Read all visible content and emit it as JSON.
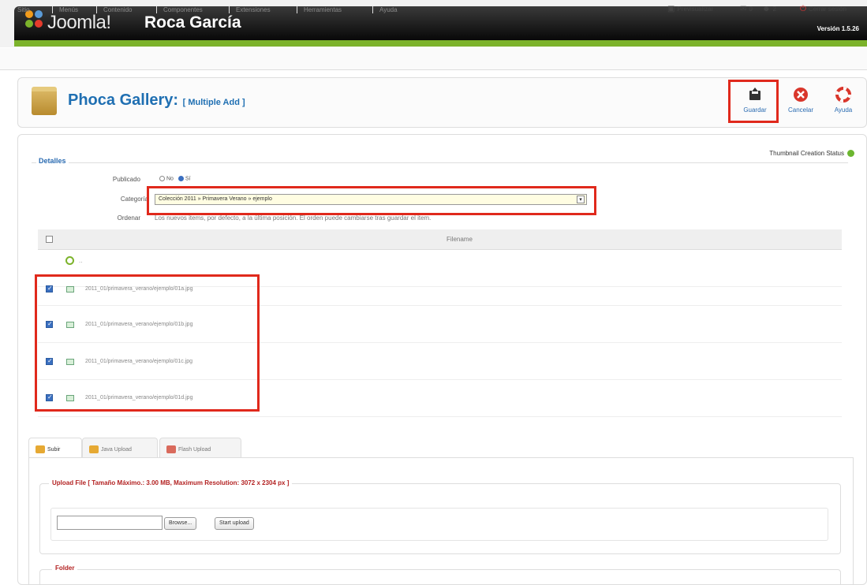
{
  "header": {
    "logo_text": "Joomla!",
    "site_name": "Roca García",
    "version": "Versión 1.5.26"
  },
  "menu": {
    "items": [
      "Sitio",
      "Menús",
      "Contenido",
      "Componentes",
      "Extensiones",
      "Herramientas",
      "Ayuda"
    ],
    "preview": "Previsualizar",
    "messages_count": "0",
    "users_count": "2",
    "logout": "Cerrar sesión"
  },
  "toolbar": {
    "title": "Phoca Gallery:",
    "subtitle": "[ Multiple Add ]",
    "save": "Guardar",
    "cancel": "Cancelar",
    "help": "Ayuda"
  },
  "details": {
    "legend": "Detalles",
    "thumbnail_status": "Thumbnail Creation Status",
    "published_label": "Publicado",
    "published_no": "No",
    "published_yes": "Sí",
    "category_label": "Categoría",
    "category_value": "Colección 2011 » Primavera Verano » ejemplo",
    "ordering_label": "Ordenar",
    "ordering_text": "Los nuevos items, por defecto, a la última posición. El orden puede cambiarse tras guardar el item.",
    "filename_header": "Filename",
    "up_text": "..",
    "files": [
      "2011_01/primavera_verano/ejemplo/01a.jpg",
      "2011_01/primavera_verano/ejemplo/01b.jpg",
      "2011_01/primavera_verano/ejemplo/01c.jpg",
      "2011_01/primavera_verano/ejemplo/01d.jpg"
    ]
  },
  "upload": {
    "tabs": [
      "Subir",
      "Java Upload",
      "Flash Upload"
    ],
    "legend": "Upload File [ Tamaño Máximo.: 3.00 MB, Maximum Resolution: 3072 x 2304 px ]",
    "browse": "Browse...",
    "start": "Start upload",
    "folder_legend": "Folder"
  },
  "colors": {
    "highlight": "#e0291c",
    "joomla_green": "#7cb32b",
    "title_blue": "#1f6fb2",
    "legend_red": "#b32222"
  }
}
